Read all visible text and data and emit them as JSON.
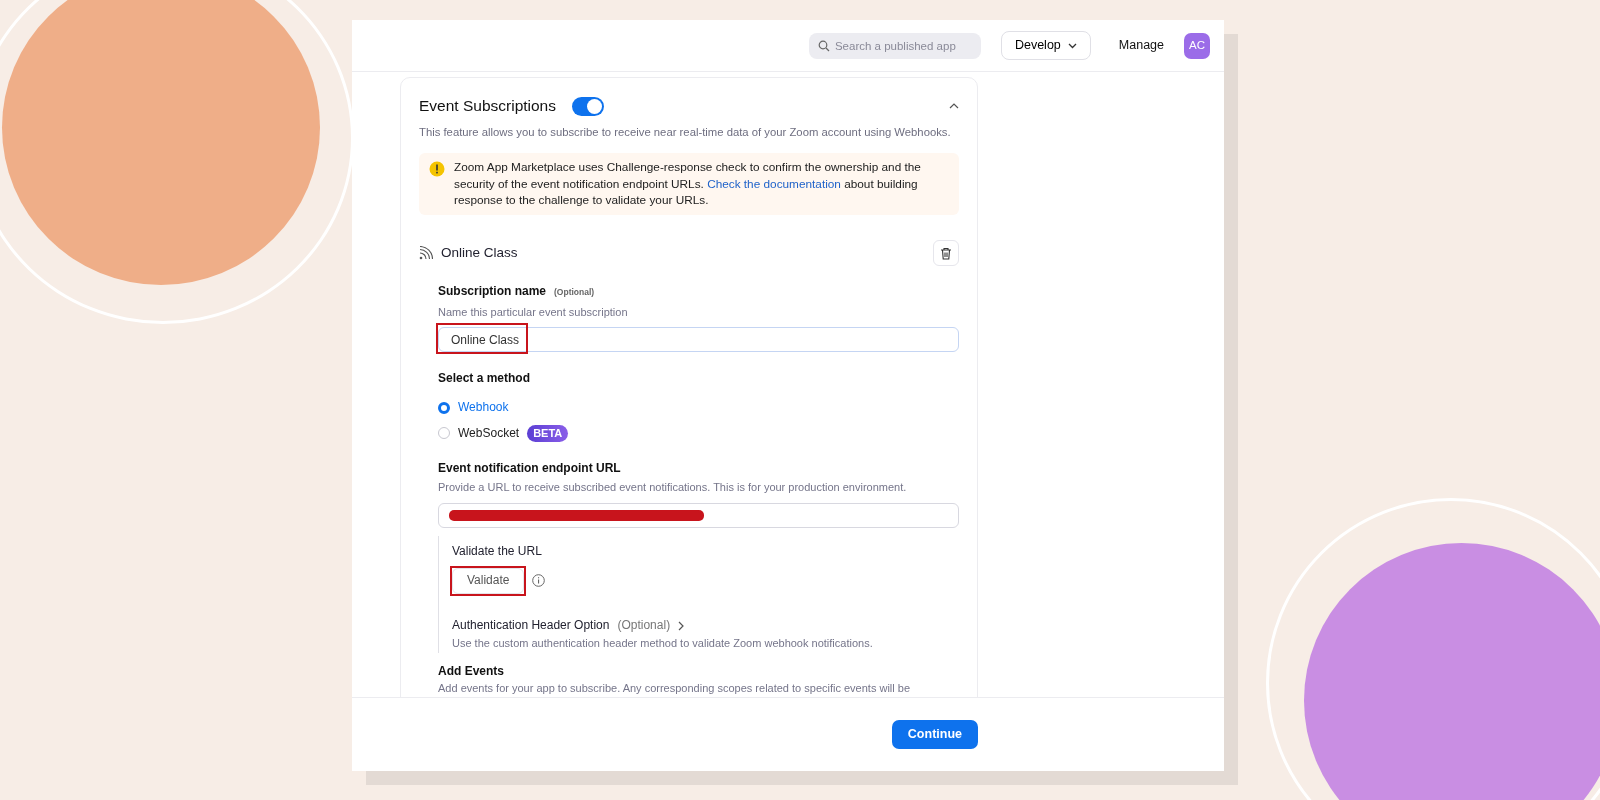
{
  "header": {
    "search": {
      "placeholder": "Search a published app"
    },
    "menu_button": "Develop",
    "link": "Manage",
    "avatar": "AC"
  },
  "section": {
    "title": "Event Subscriptions",
    "enabled": true,
    "expanded": true,
    "description": "This feature allows you to subscribe to receive near real-time data of your Zoom account using Webhooks.",
    "notice": {
      "before": "Zoom App Marketplace uses Challenge-response check to confirm the ownership and the security of the event notification endpoint URLs.",
      "link": "Check the documentation",
      "after": "about building response to the challenge to validate your URLs."
    },
    "subscription": {
      "title": "Online Class",
      "name_field": {
        "label": "Subscription name",
        "optional": "(Optional)",
        "hint": "Name this particular event subscription",
        "value": "Online Class",
        "highlighted": true
      },
      "method": {
        "label": "Select a method",
        "options": [
          {
            "label": "Webhook",
            "selected": true
          },
          {
            "label": "WebSocket",
            "selected": false,
            "badge": "BETA"
          }
        ]
      },
      "endpoint": {
        "label": "Event notification endpoint URL",
        "hint": "Provide a URL to receive subscribed event notifications. This is for your production environment.",
        "redacted": true
      },
      "validate": {
        "label": "Validate the URL",
        "button": "Validate",
        "highlighted": true
      },
      "auth": {
        "label": "Authentication Header Option",
        "optional": "(Optional)",
        "hint": "Use the custom authentication header method to validate Zoom webhook notifications."
      },
      "events": {
        "label": "Add Events",
        "hint": "Add events for your app to subscribe. Any corresponding scopes related to specific events will be"
      }
    }
  },
  "footer": {
    "button": "Continue"
  }
}
